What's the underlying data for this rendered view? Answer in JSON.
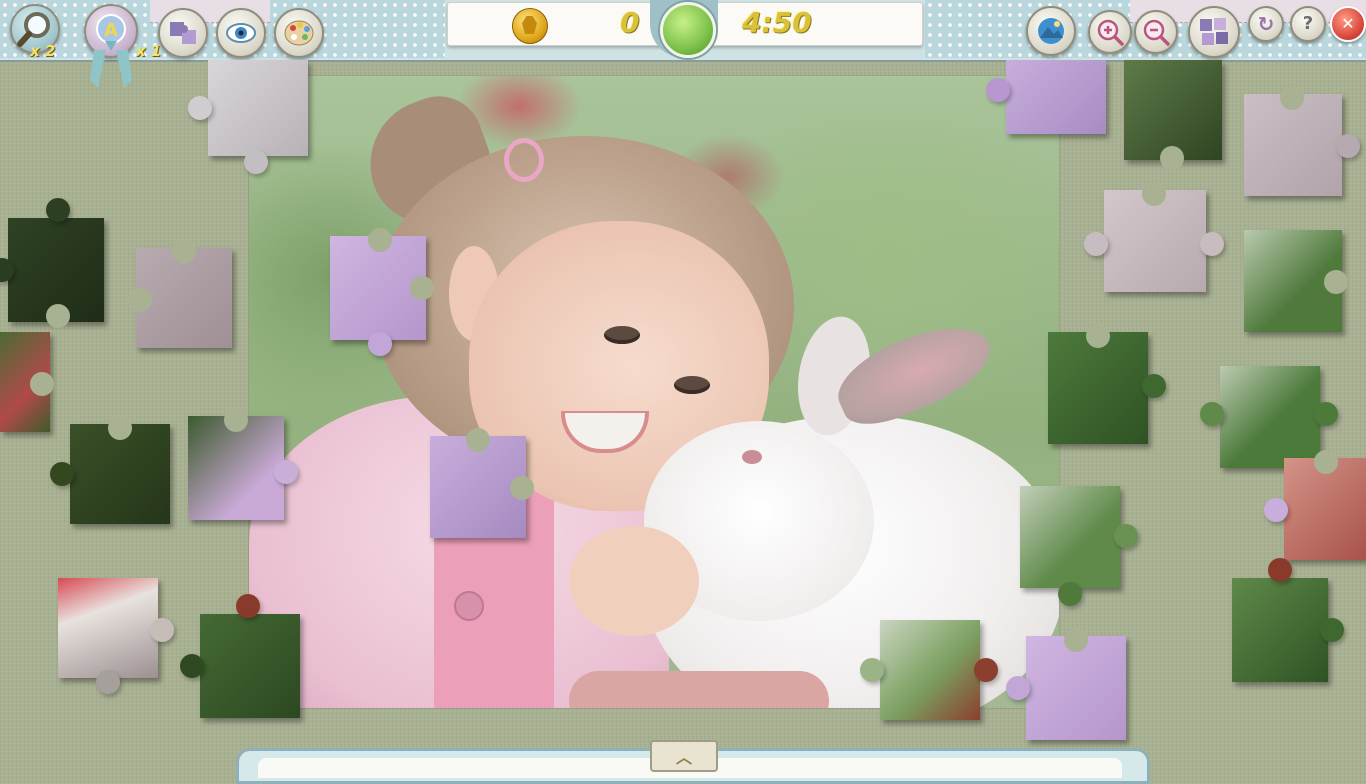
{
  "hud": {
    "hint_count": "x 2",
    "ghost_count": "x 1",
    "score": "0",
    "timer": "4:50"
  },
  "icons": {
    "magnifier": "magnifier-icon",
    "auto_place": "auto-place-icon",
    "edge_pieces": "edge-pieces-icon",
    "preview_eye": "eye-icon",
    "palette": "palette-icon",
    "coin": "coin-icon",
    "picture": "picture-icon",
    "zoom_in": "zoom-in-icon",
    "zoom_out": "zoom-out-icon",
    "shuffle": "shuffle-pieces-icon",
    "restart": "restart-icon",
    "help": "help-icon",
    "close": "close-icon",
    "tray_toggle": "chevron-up-icon"
  },
  "colors": {
    "board": "#a9b193",
    "hud_text": "#d9c23a",
    "accent_green": "#7cc14a",
    "close_red": "#d8453a",
    "lilac_piece": "#c8aedc"
  },
  "glyphs": {
    "help": "?",
    "close": "✕",
    "restart": "↻",
    "chevron": "︿"
  }
}
